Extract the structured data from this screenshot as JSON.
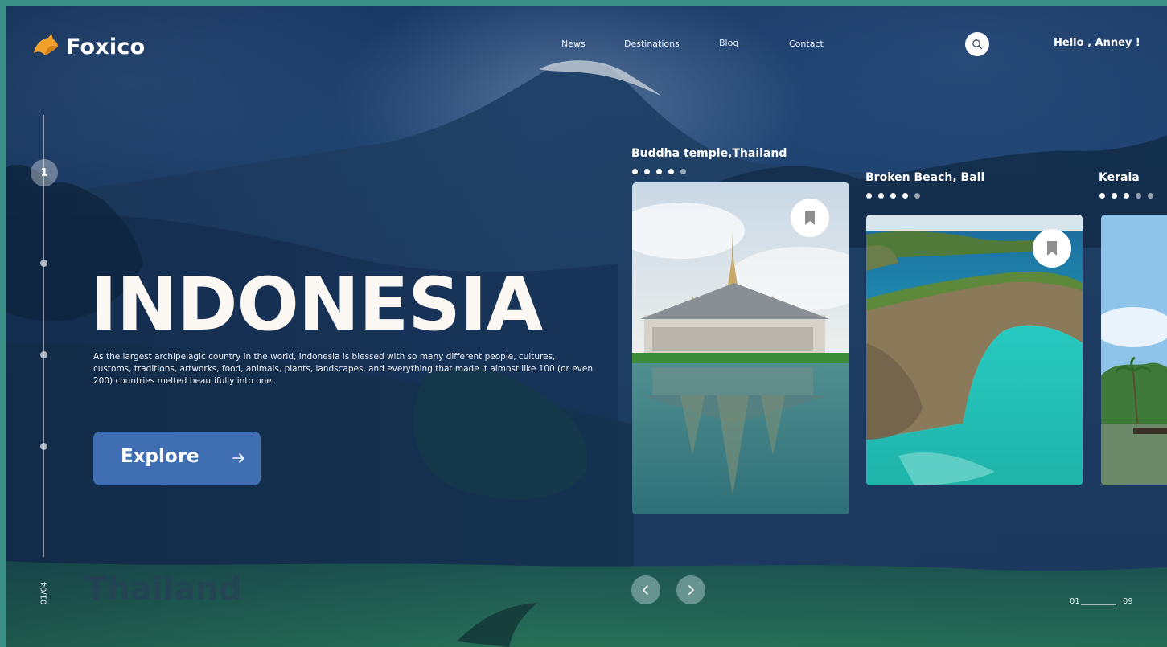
{
  "brand": {
    "name": "Foxico",
    "logo_icon": "fox-logo-icon",
    "logo_color": "#f2a12c"
  },
  "nav": {
    "items": [
      {
        "label": "News"
      },
      {
        "label": "Destinations"
      },
      {
        "label": "Blog"
      },
      {
        "label": "Contact"
      }
    ],
    "search_icon": "search-icon",
    "greeting": "Hello , Anney !"
  },
  "slider": {
    "active_index": "1",
    "counter": "01/04"
  },
  "hero": {
    "title": "INDONESIA",
    "description": "As the largest archipelagic country in the world, Indonesia is blessed with so many different people, cultures, customs, traditions, artworks, food, animals, plants, landscapes, and everything that made it almost like 100 (or even 200) countries melted beautifully into one.",
    "explore_label": "Explore",
    "explore_color": "#3f6fb2",
    "next_destination": "Thailand"
  },
  "cards": [
    {
      "title": "Buddha temple,Thailand",
      "rating_dots_filled": 4,
      "rating_dots_total": 5
    },
    {
      "title": "Broken Beach, Bali",
      "rating_dots_filled": 4,
      "rating_dots_total": 5
    },
    {
      "title": "Kerala",
      "rating_dots_filled": 3,
      "rating_dots_total": 5
    }
  ],
  "pager": {
    "start": "01",
    "end": "09"
  }
}
